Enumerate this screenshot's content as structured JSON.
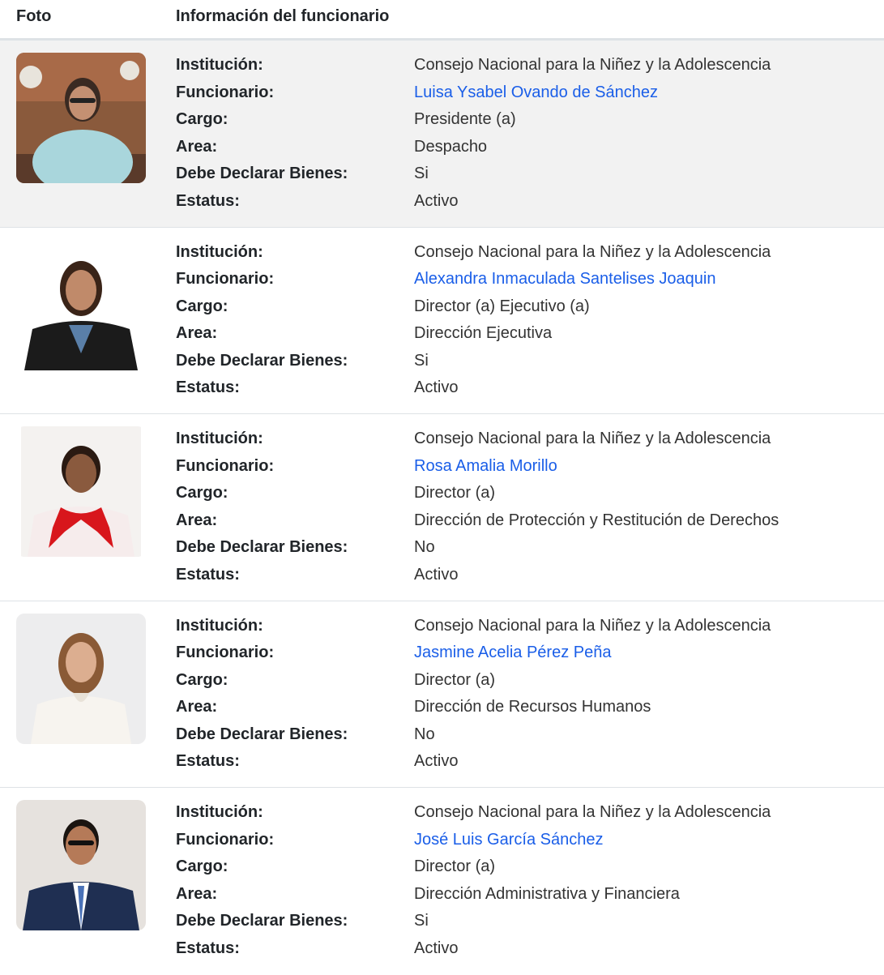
{
  "header": {
    "foto": "Foto",
    "info": "Información del funcionario"
  },
  "labels": {
    "institucion": "Institución:",
    "funcionario": "Funcionario:",
    "cargo": "Cargo:",
    "area": "Area:",
    "declarar": "Debe Declarar Bienes:",
    "estatus": "Estatus:"
  },
  "colors": {
    "link": "#1a5ee8",
    "row_shaded": "#f2f2f2"
  },
  "rows": [
    {
      "institucion": "Consejo Nacional para la Niñez y la Adolescencia",
      "funcionario": "Luisa Ysabel Ovando de Sánchez",
      "cargo": "Presidente (a)",
      "area": "Despacho",
      "declarar": "Si",
      "estatus": "Activo"
    },
    {
      "institucion": "Consejo Nacional para la Niñez y la Adolescencia",
      "funcionario": "Alexandra Inmaculada Santelises Joaquin",
      "cargo": "Director (a) Ejecutivo (a)",
      "area": "Dirección Ejecutiva",
      "declarar": "Si",
      "estatus": "Activo"
    },
    {
      "institucion": "Consejo Nacional para la Niñez y la Adolescencia",
      "funcionario": "Rosa Amalia Morillo",
      "cargo": "Director (a)",
      "area": "Dirección de Protección y Restitución de Derechos",
      "declarar": "No",
      "estatus": "Activo"
    },
    {
      "institucion": "Consejo Nacional para la Niñez y la Adolescencia",
      "funcionario": "Jasmine Acelia Pérez Peña",
      "cargo": "Director (a)",
      "area": "Dirección de Recursos Humanos",
      "declarar": "No",
      "estatus": "Activo"
    },
    {
      "institucion": "Consejo Nacional para la Niñez y la Adolescencia",
      "funcionario": "José Luis García Sánchez",
      "cargo": "Director (a)",
      "area": "Dirección Administrativa y Financiera",
      "declarar": "Si",
      "estatus": "Activo"
    }
  ]
}
